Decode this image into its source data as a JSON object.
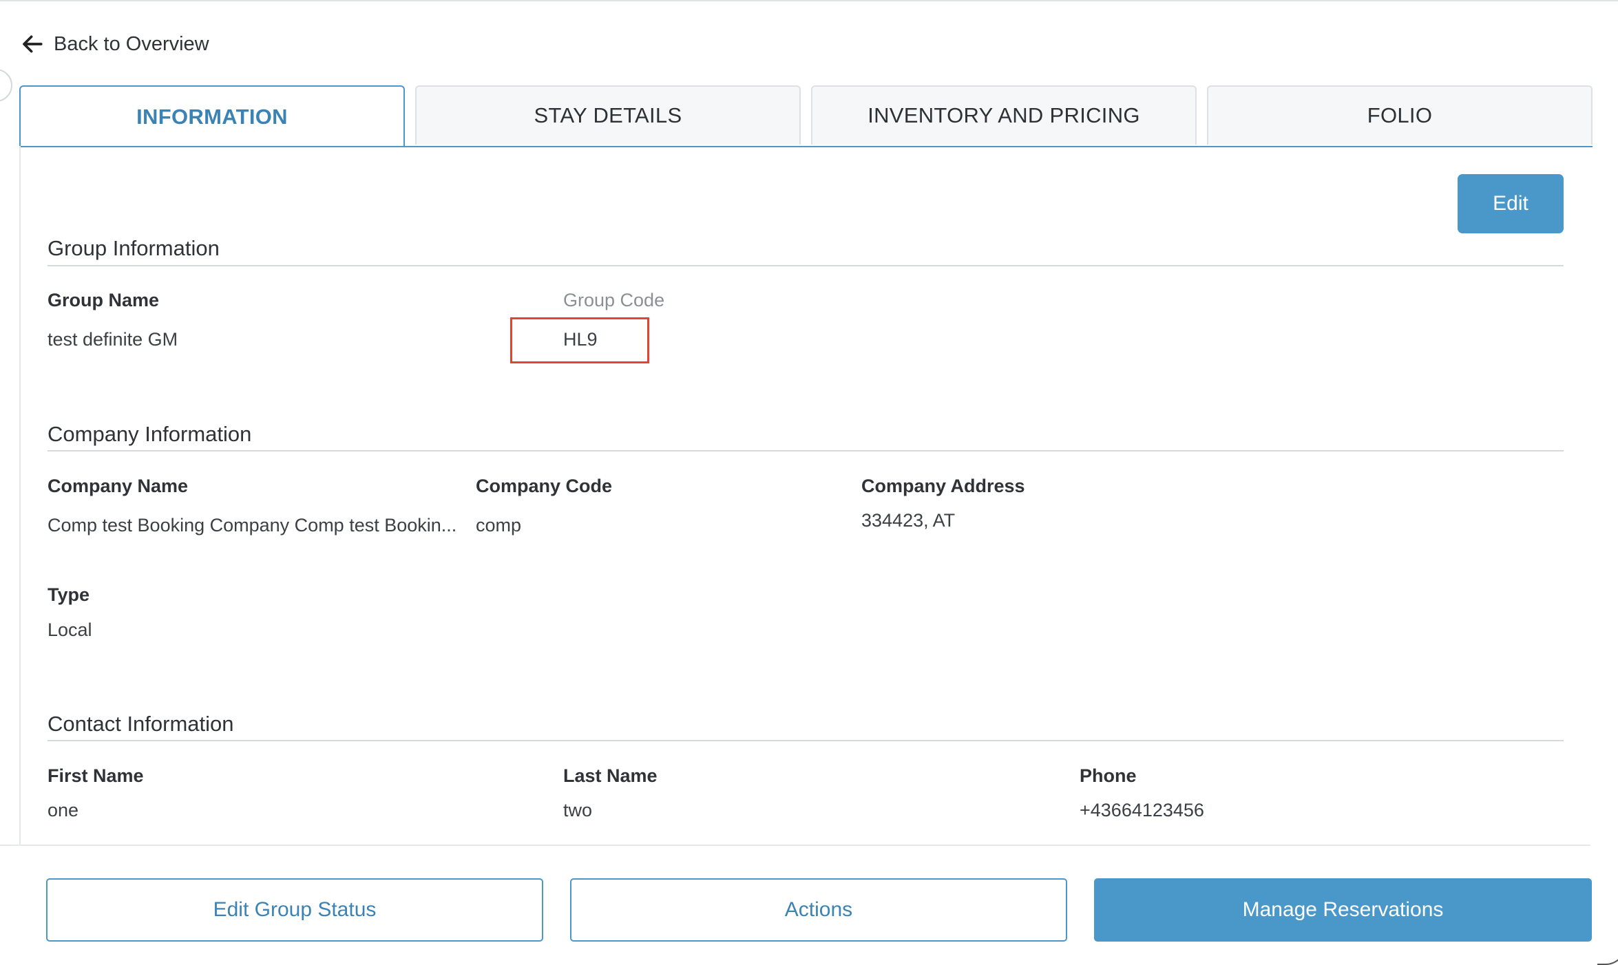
{
  "nav": {
    "back_label": "Back to Overview"
  },
  "tabs": [
    {
      "label": "INFORMATION",
      "active": true
    },
    {
      "label": "STAY DETAILS",
      "active": false
    },
    {
      "label": "INVENTORY AND PRICING",
      "active": false
    },
    {
      "label": "FOLIO",
      "active": false
    }
  ],
  "toolbar": {
    "edit_label": "Edit"
  },
  "group_info": {
    "title": "Group Information",
    "group_name_label": "Group Name",
    "group_name_value": "test definite GM",
    "group_code_label": "Group Code",
    "group_code_value": "HL9"
  },
  "company_info": {
    "title": "Company Information",
    "company_name_label": "Company Name",
    "company_name_value": "Comp test Booking Company Comp test Bookin...",
    "company_code_label": "Company Code",
    "company_code_value": "comp",
    "company_address_label": "Company Address",
    "company_address_value": "334423, AT",
    "type_label": "Type",
    "type_value": "Local"
  },
  "contact_info": {
    "title": "Contact Information",
    "first_name_label": "First Name",
    "first_name_value": "one",
    "last_name_label": "Last Name",
    "last_name_value": "two",
    "phone_label": "Phone",
    "phone_value": "+43664123456"
  },
  "footer": {
    "edit_group_status_label": "Edit Group Status",
    "actions_label": "Actions",
    "manage_reservations_label": "Manage Reservations"
  },
  "colors": {
    "accent": "#4a98c9",
    "highlight": "#e2452f"
  },
  "icons": {
    "back": "arrow-left-icon"
  }
}
